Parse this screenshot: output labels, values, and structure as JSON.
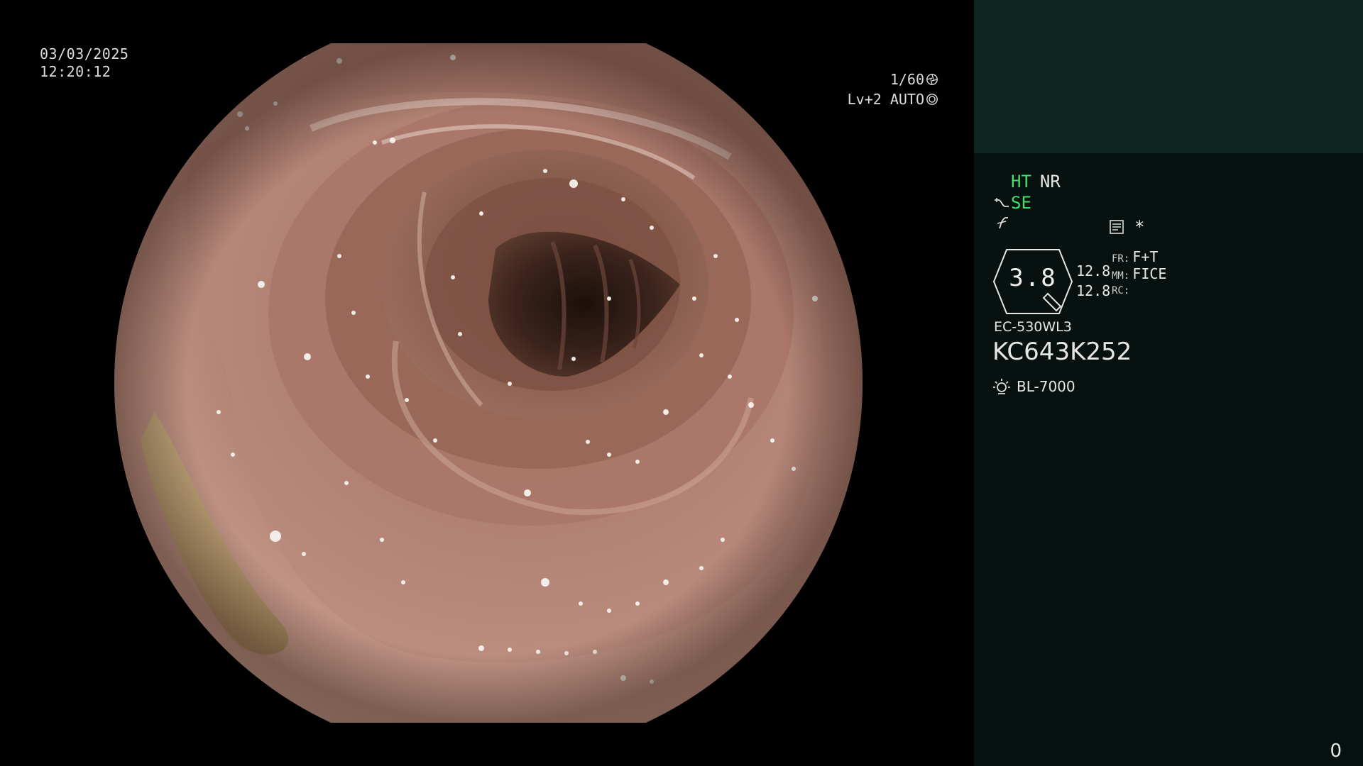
{
  "overlay": {
    "date": "03/03/2025",
    "time": "12:20:12",
    "shutter": "1/60",
    "shutter_icon": "aperture-icon",
    "iris_mode": "Lv+2 AUTO",
    "iris_icon": "iris-icon"
  },
  "panel": {
    "ht_label": "HT",
    "nr_label": "NR",
    "se_label": "SE",
    "se_icon": "contrast-curve-icon",
    "f_icon": "f-symbol-icon",
    "memory_icon": "memo-icon",
    "asterisk": "*",
    "ratio_value": "3.8",
    "num1": "12.8",
    "num2": "12.8",
    "fr_key": "FR:",
    "fr_value": "F+T",
    "mm_key": "MM:",
    "mm_value": "FICE",
    "rc_key": "RC:",
    "rc_value": "",
    "scope_model": "EC-530WL3",
    "scope_serial": "KC643K252",
    "light_icon": "lamp-icon",
    "light_source": "BL-7000",
    "frame_counter": "0"
  },
  "colors": {
    "panel_bg": "#07110f",
    "panel_top_bg": "#0f2522",
    "accent_green": "#3fe06a",
    "text": "#e6e6e6"
  }
}
